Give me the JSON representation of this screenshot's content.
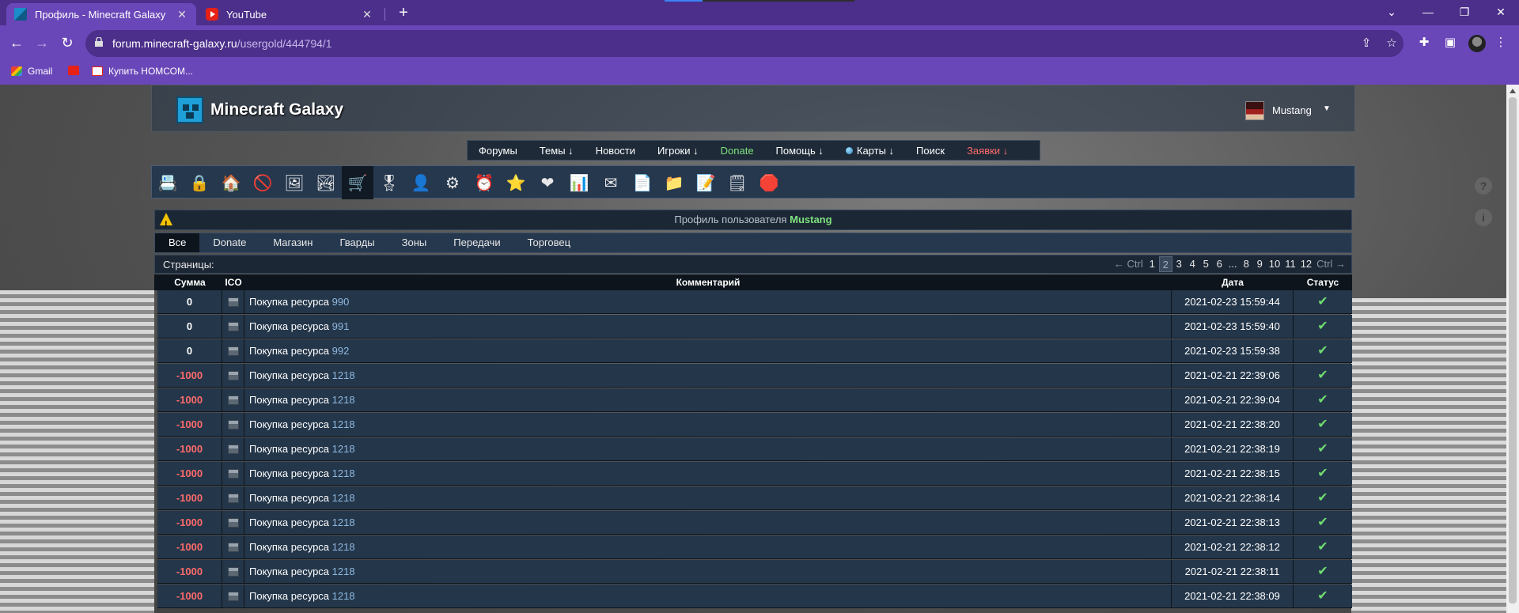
{
  "browser": {
    "tabs": [
      {
        "title": "Профиль - Minecraft Galaxy",
        "active": true
      },
      {
        "title": "YouTube",
        "active": false
      }
    ],
    "url": {
      "host": "forum.minecraft-galaxy.ru",
      "path": "/usergold/444794/1"
    },
    "bookmarks": [
      {
        "label": "Gmail",
        "icon": "gmail-icon"
      },
      {
        "label": "",
        "icon": "youtube-icon"
      },
      {
        "label": "Купить НОМСОМ...",
        "icon": "ozon-icon"
      }
    ]
  },
  "site": {
    "logo_text": "Minecraft Galaxy",
    "user": "Mustang",
    "nav": [
      {
        "label": "Форумы",
        "style": "normal"
      },
      {
        "label": "Темы ↓",
        "style": "normal"
      },
      {
        "label": "Новости",
        "style": "normal"
      },
      {
        "label": "Игроки ↓",
        "style": "normal"
      },
      {
        "label": "Donate",
        "style": "green"
      },
      {
        "label": "Помощь ↓",
        "style": "normal"
      },
      {
        "label": "Карты ↓",
        "style": "normal"
      },
      {
        "label": "Поиск",
        "style": "normal"
      },
      {
        "label": "Заявки ↓",
        "style": "red"
      }
    ],
    "icons": [
      "address-book-icon",
      "lock-icon",
      "home-icon",
      "ban-icon",
      "picture-icon",
      "landscape-icon",
      "cart-icon",
      "medal-icon",
      "user-icon",
      "gear-icon",
      "alarm-clock-icon",
      "star-icon",
      "heart-icon",
      "chart-icon",
      "mail-icon",
      "sheet-icon",
      "folder-icon",
      "notepad-icon",
      "notes-icon",
      "stop-icon"
    ],
    "profile_prefix": "Профиль пользователя",
    "filter_tabs": [
      "Все",
      "Donate",
      "Магазин",
      "Гварды",
      "Зоны",
      "Передачи",
      "Торговец"
    ],
    "pages_label": "Страницы:",
    "pager": [
      "← Ctrl",
      "1",
      "2",
      "3",
      "4",
      "5",
      "6",
      "...",
      "8",
      "9",
      "10",
      "11",
      "12",
      "Ctrl →"
    ],
    "current_page": "2",
    "table": {
      "headers": {
        "sum": "Сумма",
        "ico": "ICO",
        "comment": "Комментарий",
        "date": "Дата",
        "status": "Статус"
      },
      "rows": [
        {
          "sum": "0",
          "comment": "Покупка ресурса",
          "res": "990",
          "date": "2021-02-23 15:59:44"
        },
        {
          "sum": "0",
          "comment": "Покупка ресурса",
          "res": "991",
          "date": "2021-02-23 15:59:40"
        },
        {
          "sum": "0",
          "comment": "Покупка ресурса",
          "res": "992",
          "date": "2021-02-23 15:59:38"
        },
        {
          "sum": "-1000",
          "comment": "Покупка ресурса",
          "res": "1218",
          "date": "2021-02-21 22:39:06"
        },
        {
          "sum": "-1000",
          "comment": "Покупка ресурса",
          "res": "1218",
          "date": "2021-02-21 22:39:04"
        },
        {
          "sum": "-1000",
          "comment": "Покупка ресурса",
          "res": "1218",
          "date": "2021-02-21 22:38:20"
        },
        {
          "sum": "-1000",
          "comment": "Покупка ресурса",
          "res": "1218",
          "date": "2021-02-21 22:38:19"
        },
        {
          "sum": "-1000",
          "comment": "Покупка ресурса",
          "res": "1218",
          "date": "2021-02-21 22:38:15"
        },
        {
          "sum": "-1000",
          "comment": "Покупка ресурса",
          "res": "1218",
          "date": "2021-02-21 22:38:14"
        },
        {
          "sum": "-1000",
          "comment": "Покупка ресурса",
          "res": "1218",
          "date": "2021-02-21 22:38:13"
        },
        {
          "sum": "-1000",
          "comment": "Покупка ресурса",
          "res": "1218",
          "date": "2021-02-21 22:38:12"
        },
        {
          "sum": "-1000",
          "comment": "Покупка ресурса",
          "res": "1218",
          "date": "2021-02-21 22:38:11"
        },
        {
          "sum": "-1000",
          "comment": "Покупка ресурса",
          "res": "1218",
          "date": "2021-02-21 22:38:09"
        }
      ]
    }
  }
}
